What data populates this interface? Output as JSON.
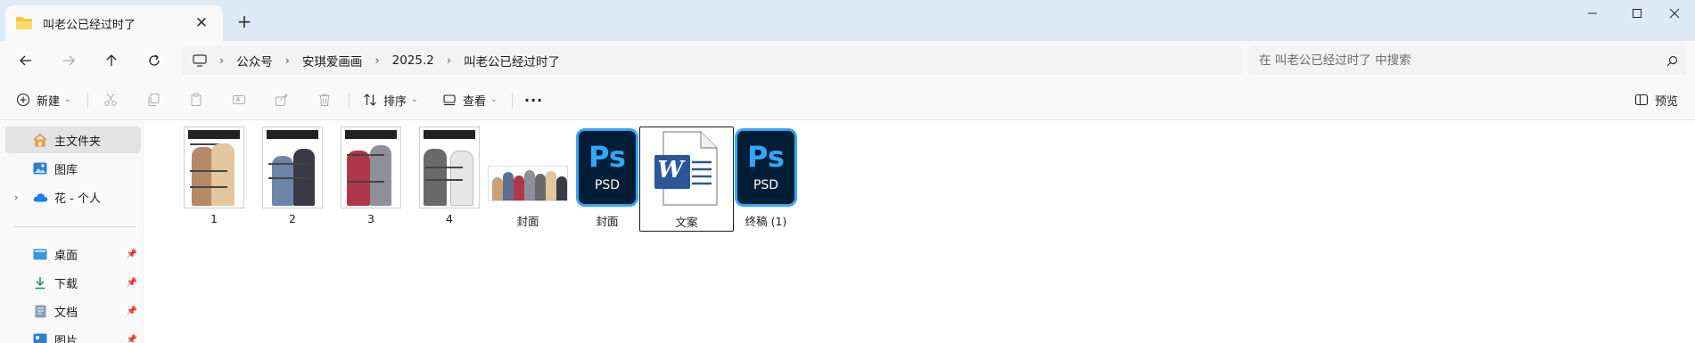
{
  "window": {
    "tab_title": "叫老公已经过时了",
    "new_tab": "+",
    "close_tab": "✕"
  },
  "breadcrumb": [
    "公众号",
    "安琪爱画画",
    "2025.2",
    "叫老公已经过时了"
  ],
  "search": {
    "placeholder": "在 叫老公已经过时了 中搜索"
  },
  "toolbar": {
    "new_label": "新建",
    "sort_label": "排序",
    "view_label": "查看",
    "more_label": "···",
    "preview_label": "预览"
  },
  "sidebar": {
    "items": [
      {
        "label": "主文件夹",
        "icon": "home-icon",
        "active": true
      },
      {
        "label": "图库",
        "icon": "gallery-icon"
      },
      {
        "label": "花 - 个人",
        "icon": "onedrive-cloud-icon"
      },
      {
        "label": "桌面",
        "icon": "desktop-icon",
        "pinned": true
      },
      {
        "label": "下载",
        "icon": "download-icon",
        "pinned": true
      },
      {
        "label": "文档",
        "icon": "document-icon",
        "pinned": true
      },
      {
        "label": "图片",
        "icon": "pictures-icon",
        "pinned": true
      }
    ]
  },
  "files": [
    {
      "name": "1",
      "type": "image"
    },
    {
      "name": "2",
      "type": "image"
    },
    {
      "name": "3",
      "type": "image"
    },
    {
      "name": "4",
      "type": "image"
    },
    {
      "name": "封面",
      "type": "image"
    },
    {
      "name": "封面",
      "type": "psd",
      "icon_text": "Ps",
      "icon_sub": "PSD"
    },
    {
      "name": "文案",
      "type": "docx",
      "selected": true,
      "icon_text": "W"
    },
    {
      "name": "终稿 (1)",
      "type": "psd",
      "icon_text": "Ps",
      "icon_sub": "PSD"
    }
  ],
  "colors": {
    "titlebar": "#dde9f5",
    "ps_bg": "#001e36",
    "ps_accent": "#31a8ff",
    "word_blue": "#2b579a"
  }
}
